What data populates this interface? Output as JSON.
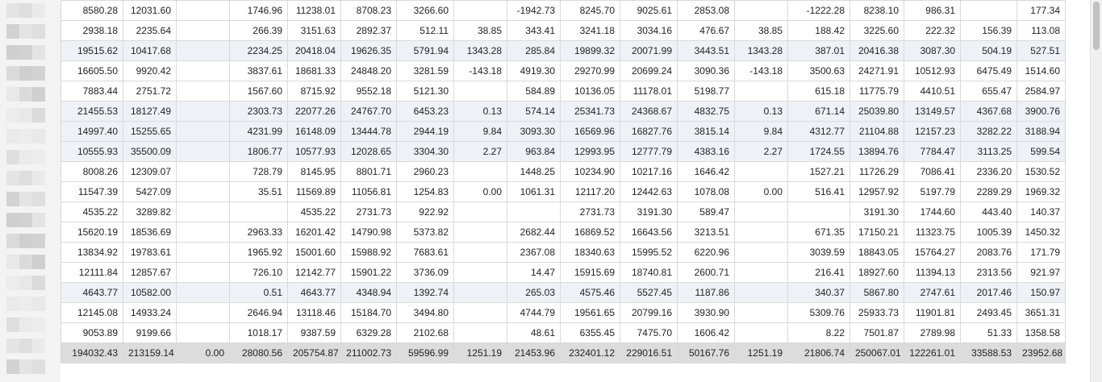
{
  "grid": {
    "rows": [
      {
        "shaded": false,
        "cells": [
          "8580.28",
          "12031.60",
          "",
          "1746.96",
          "11238.01",
          "8708.23",
          "3266.60",
          "",
          "-1942.73",
          "8245.70",
          "9025.61",
          "2853.08",
          "",
          "-1222.28",
          "8238.10",
          "986.31",
          "",
          "177.34"
        ]
      },
      {
        "shaded": false,
        "cells": [
          "2938.18",
          "2235.64",
          "",
          "266.39",
          "3151.63",
          "2892.37",
          "512.11",
          "38.85",
          "343.41",
          "3241.18",
          "3034.16",
          "476.67",
          "38.85",
          "188.42",
          "3225.60",
          "222.32",
          "156.39",
          "113.08"
        ]
      },
      {
        "shaded": true,
        "cells": [
          "19515.62",
          "10417.68",
          "",
          "2234.25",
          "20418.04",
          "19626.35",
          "5791.94",
          "1343.28",
          "285.84",
          "19899.32",
          "20071.99",
          "3443.51",
          "1343.28",
          "387.01",
          "20416.38",
          "3087.30",
          "504.19",
          "527.51"
        ]
      },
      {
        "shaded": false,
        "cells": [
          "16605.50",
          "9920.42",
          "",
          "3837.61",
          "18681.33",
          "24848.20",
          "3281.59",
          "-143.18",
          "4919.30",
          "29270.99",
          "20699.24",
          "3090.36",
          "-143.18",
          "3500.63",
          "24271.91",
          "10512.93",
          "6475.49",
          "1514.60"
        ]
      },
      {
        "shaded": false,
        "cells": [
          "7883.44",
          "2751.72",
          "",
          "1567.60",
          "8715.92",
          "9552.18",
          "5121.30",
          "",
          "584.89",
          "10136.05",
          "11178.01",
          "5198.77",
          "",
          "615.18",
          "11775.79",
          "4410.51",
          "655.47",
          "2584.97"
        ]
      },
      {
        "shaded": true,
        "cells": [
          "21455.53",
          "18127.49",
          "",
          "2303.73",
          "22077.26",
          "24767.70",
          "6453.23",
          "0.13",
          "574.14",
          "25341.73",
          "24368.67",
          "4832.75",
          "0.13",
          "671.14",
          "25039.80",
          "13149.57",
          "4367.68",
          "3900.76"
        ]
      },
      {
        "shaded": true,
        "cells": [
          "14997.40",
          "15255.65",
          "",
          "4231.99",
          "16148.09",
          "13444.78",
          "2944.19",
          "9.84",
          "3093.30",
          "16569.96",
          "16827.76",
          "3815.14",
          "9.84",
          "4312.77",
          "21104.88",
          "12157.23",
          "3282.22",
          "3188.94"
        ]
      },
      {
        "shaded": true,
        "cells": [
          "10555.93",
          "35500.09",
          "",
          "1806.77",
          "10577.93",
          "12028.65",
          "3304.30",
          "2.27",
          "963.84",
          "12993.95",
          "12777.79",
          "4383.16",
          "2.27",
          "1724.55",
          "13894.76",
          "7784.47",
          "3113.25",
          "599.54"
        ]
      },
      {
        "shaded": false,
        "cells": [
          "8008.26",
          "12309.07",
          "",
          "728.79",
          "8145.95",
          "8801.71",
          "2960.23",
          "",
          "1448.25",
          "10234.90",
          "10217.16",
          "1646.42",
          "",
          "1527.21",
          "11726.29",
          "7086.41",
          "2336.20",
          "1530.52"
        ]
      },
      {
        "shaded": false,
        "cells": [
          "11547.39",
          "5427.09",
          "",
          "35.51",
          "11569.89",
          "11056.81",
          "1254.83",
          "0.00",
          "1061.31",
          "12117.20",
          "12442.63",
          "1078.08",
          "0.00",
          "516.41",
          "12957.92",
          "5197.79",
          "2289.29",
          "1969.32"
        ]
      },
      {
        "shaded": false,
        "cells": [
          "4535.22",
          "3289.82",
          "",
          "",
          "4535.22",
          "2731.73",
          "922.92",
          "",
          "",
          "2731.73",
          "3191.30",
          "589.47",
          "",
          "",
          "3191.30",
          "1744.60",
          "443.40",
          "140.37"
        ]
      },
      {
        "shaded": false,
        "cells": [
          "15620.19",
          "18536.69",
          "",
          "2963.33",
          "16201.42",
          "14790.98",
          "5373.82",
          "",
          "2682.44",
          "16869.52",
          "16643.56",
          "3213.51",
          "",
          "671.35",
          "17150.21",
          "11323.75",
          "1005.39",
          "1450.32"
        ]
      },
      {
        "shaded": false,
        "cells": [
          "13834.92",
          "19783.61",
          "",
          "1965.92",
          "15001.60",
          "15988.92",
          "7683.61",
          "",
          "2367.08",
          "18340.63",
          "15995.52",
          "6220.96",
          "",
          "3039.59",
          "18843.05",
          "15764.27",
          "2083.76",
          "171.79"
        ]
      },
      {
        "shaded": false,
        "cells": [
          "12111.84",
          "12857.67",
          "",
          "726.10",
          "12142.77",
          "15901.22",
          "3736.09",
          "",
          "14.47",
          "15915.69",
          "18740.81",
          "2600.71",
          "",
          "216.41",
          "18927.60",
          "11394.13",
          "2313.56",
          "921.97"
        ]
      },
      {
        "shaded": true,
        "cells": [
          "4643.77",
          "10582.00",
          "",
          "0.51",
          "4643.77",
          "4348.94",
          "1392.74",
          "",
          "265.03",
          "4575.46",
          "5527.45",
          "1187.86",
          "",
          "340.37",
          "5867.80",
          "2747.61",
          "2017.46",
          "150.97"
        ]
      },
      {
        "shaded": false,
        "cells": [
          "12145.08",
          "14933.24",
          "",
          "2646.94",
          "13118.46",
          "15184.70",
          "3494.80",
          "",
          "4744.79",
          "19561.65",
          "20799.16",
          "3930.90",
          "",
          "5309.76",
          "25933.73",
          "11901.81",
          "2493.45",
          "3651.31"
        ]
      },
      {
        "shaded": false,
        "cells": [
          "9053.89",
          "9199.66",
          "",
          "1018.17",
          "9387.59",
          "6329.28",
          "2102.68",
          "",
          "48.61",
          "6355.45",
          "7475.70",
          "1606.42",
          "",
          "8.22",
          "7501.87",
          "2789.98",
          "51.33",
          "1358.58"
        ]
      }
    ],
    "total": [
      "194032.43",
      "213159.14",
      "0.00",
      "28080.56",
      "205754.87",
      "211002.73",
      "59596.99",
      "1251.19",
      "21453.96",
      "232401.12",
      "229016.51",
      "50167.76",
      "1251.19",
      "21806.74",
      "250067.01",
      "122261.01",
      "33588.53",
      "23952.68"
    ]
  }
}
